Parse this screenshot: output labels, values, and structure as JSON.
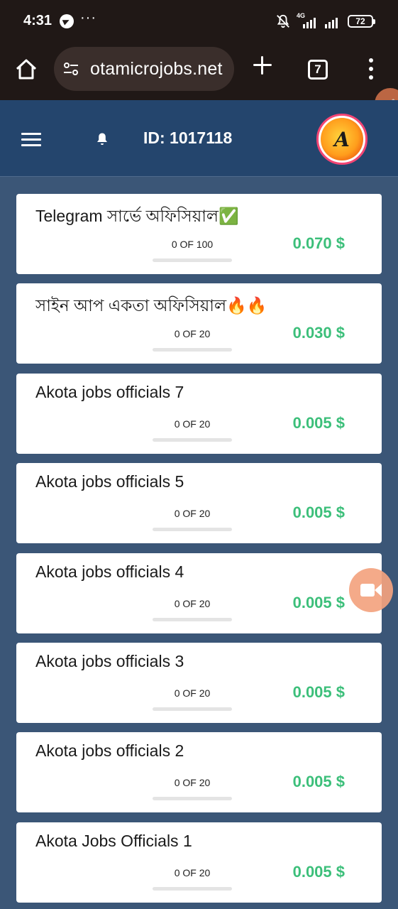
{
  "status_bar": {
    "time": "4:31",
    "more": "···",
    "network": "4G",
    "battery": "72"
  },
  "browser": {
    "url": "otamicrojobs.net",
    "tab_count": "7"
  },
  "header": {
    "user_id": "ID: 1017118",
    "logo_letter": "A"
  },
  "jobs": [
    {
      "title": "Telegram সার্ভে অফিসিয়াল✅",
      "count": "0 OF 100",
      "reward": "0.070 $",
      "progress": 0
    },
    {
      "title": "সাইন আপ একতা অফিসিয়াল🔥🔥",
      "count": "0 OF 20",
      "reward": "0.030 $",
      "progress": 0
    },
    {
      "title": "Akota jobs officials 7",
      "count": "0 OF 20",
      "reward": "0.005 $",
      "progress": 0
    },
    {
      "title": "Akota jobs officials 5",
      "count": "0 OF 20",
      "reward": "0.005 $",
      "progress": 0
    },
    {
      "title": "Akota jobs officials 4",
      "count": "0 OF 20",
      "reward": "0.005 $",
      "progress": 0
    },
    {
      "title": "Akota jobs officials 3",
      "count": "0 OF 20",
      "reward": "0.005 $",
      "progress": 0
    },
    {
      "title": "Akota jobs officials 2",
      "count": "0 OF 20",
      "reward": "0.005 $",
      "progress": 0
    },
    {
      "title": "Akota Jobs Officials 1",
      "count": "0 OF 20",
      "reward": "0.005 $",
      "progress": 0
    }
  ],
  "colors": {
    "status_bg": "#201816",
    "header_bg": "#24456d",
    "page_bg": "#3b5677",
    "reward_green": "#3cbf7a",
    "fab_orange": "#f4a37f"
  }
}
